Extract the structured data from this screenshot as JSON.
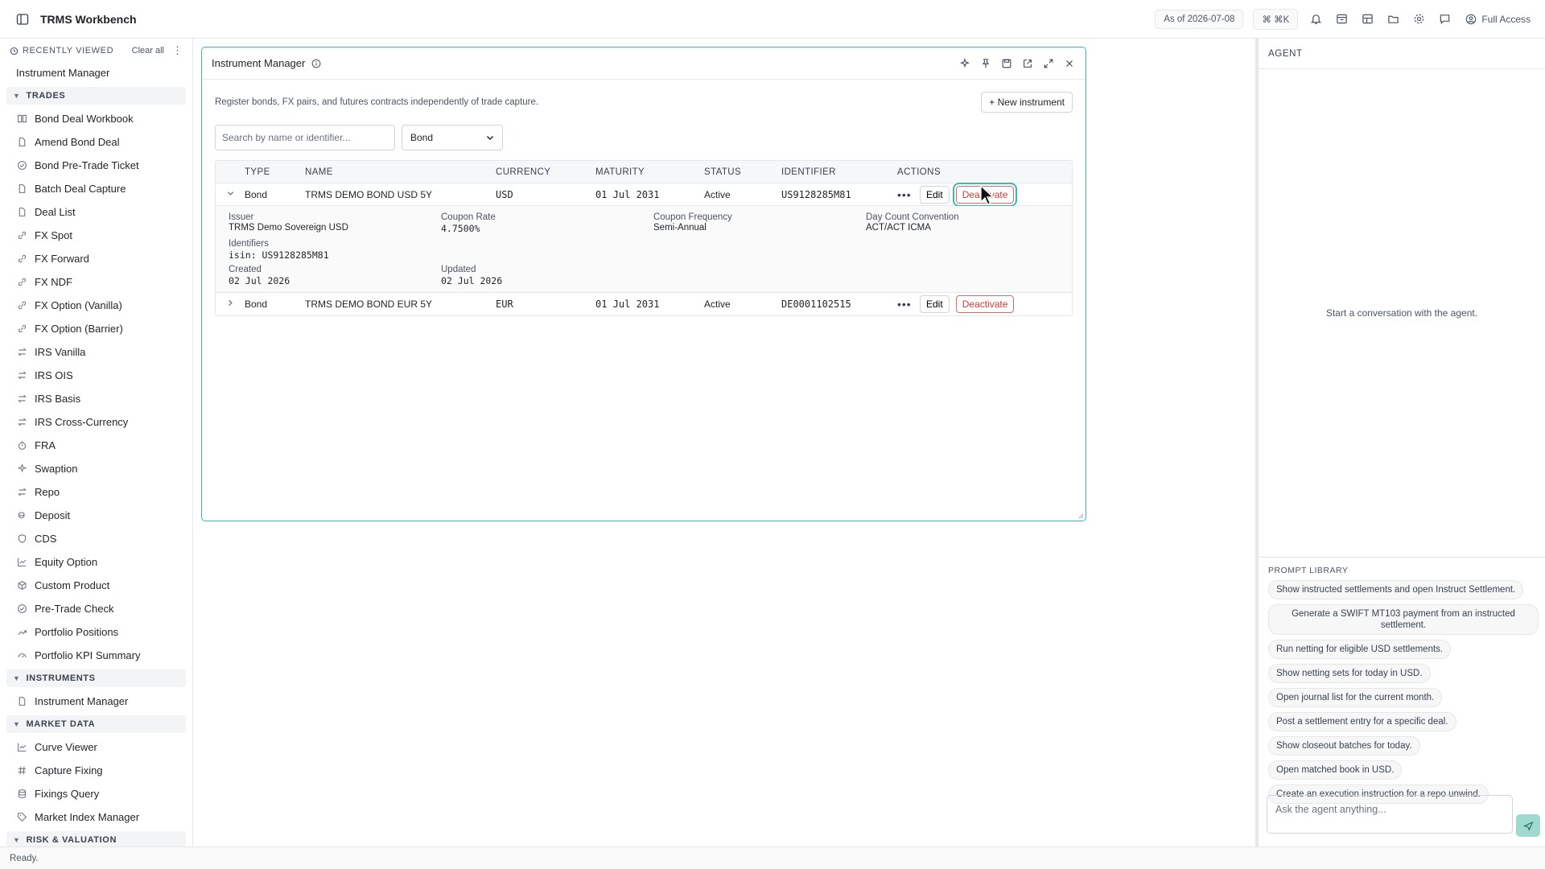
{
  "app": {
    "title": "TRMS Workbench",
    "as_of": "As of 2026-07-08",
    "shortcut": "⌘ ⌘K",
    "access": "Full Access"
  },
  "sidebar": {
    "recent_label": "RECENTLY VIEWED",
    "clear_all": "Clear all",
    "recent_item": "Instrument Manager",
    "sections": {
      "trades": "TRADES",
      "instruments": "INSTRUMENTS",
      "market_data": "MARKET DATA",
      "risk": "RISK & VALUATION"
    },
    "trades": [
      "Bond Deal Workbook",
      "Amend Bond Deal",
      "Bond Pre-Trade Ticket",
      "Batch Deal Capture",
      "Deal List",
      "FX Spot",
      "FX Forward",
      "FX NDF",
      "FX Option (Vanilla)",
      "FX Option (Barrier)",
      "IRS Vanilla",
      "IRS OIS",
      "IRS Basis",
      "IRS Cross-Currency",
      "FRA",
      "Swaption",
      "Repo",
      "Deposit",
      "CDS",
      "Equity Option",
      "Custom Product",
      "Pre-Trade Check",
      "Portfolio Positions",
      "Portfolio KPI Summary"
    ],
    "instruments": [
      "Instrument Manager"
    ],
    "market_data": [
      "Curve Viewer",
      "Capture Fixing",
      "Fixings Query",
      "Market Index Manager"
    ]
  },
  "window": {
    "title": "Instrument Manager",
    "description": "Register bonds, FX pairs, and futures contracts independently of trade capture.",
    "new_button": "+ New instrument",
    "search_placeholder": "Search by name or identifier...",
    "type_filter": "Bond",
    "columns": [
      "TYPE",
      "NAME",
      "CURRENCY",
      "MATURITY",
      "STATUS",
      "IDENTIFIER",
      "ACTIONS"
    ],
    "rows": [
      {
        "type": "Bond",
        "name": "TRMS DEMO BOND USD 5Y",
        "currency": "USD",
        "maturity": "01 Jul 2031",
        "status": "Active",
        "identifier": "US9128285M81",
        "expanded": true
      },
      {
        "type": "Bond",
        "name": "TRMS DEMO BOND EUR 5Y",
        "currency": "EUR",
        "maturity": "01 Jul 2031",
        "status": "Active",
        "identifier": "DE0001102515",
        "expanded": false
      }
    ],
    "detail": {
      "issuer_label": "Issuer",
      "issuer": "TRMS Demo Sovereign USD",
      "coupon_rate_label": "Coupon Rate",
      "coupon_rate": "4.7500%",
      "coupon_freq_label": "Coupon Frequency",
      "coupon_freq": "Semi-Annual",
      "day_count_label": "Day Count Convention",
      "day_count": "ACT/ACT ICMA",
      "identifiers_label": "Identifiers",
      "identifiers": "isin: US9128285M81",
      "created_label": "Created",
      "created": "02 Jul 2026",
      "updated_label": "Updated",
      "updated": "02 Jul 2026"
    },
    "edit_label": "Edit",
    "deactivate_label": "Deactivate"
  },
  "agent": {
    "title": "AGENT",
    "empty": "Start a conversation with the agent.",
    "library_label": "PROMPT LIBRARY",
    "prompts": [
      "Show instructed settlements and open Instruct Settlement.",
      "Generate a SWIFT MT103 payment from an instructed settlement.",
      "Run netting for eligible USD settlements.",
      "Show netting sets for today in USD.",
      "Open journal list for the current month.",
      "Post a settlement entry for a specific deal.",
      "Show closeout batches for today.",
      "Open matched book in USD.",
      "Create an execution instruction for a repo unwind."
    ],
    "input_placeholder": "Ask the agent anything..."
  },
  "status": {
    "text": "Ready."
  },
  "colors": {
    "accent": "#3fb8ad",
    "danger": "#d03a3a"
  }
}
